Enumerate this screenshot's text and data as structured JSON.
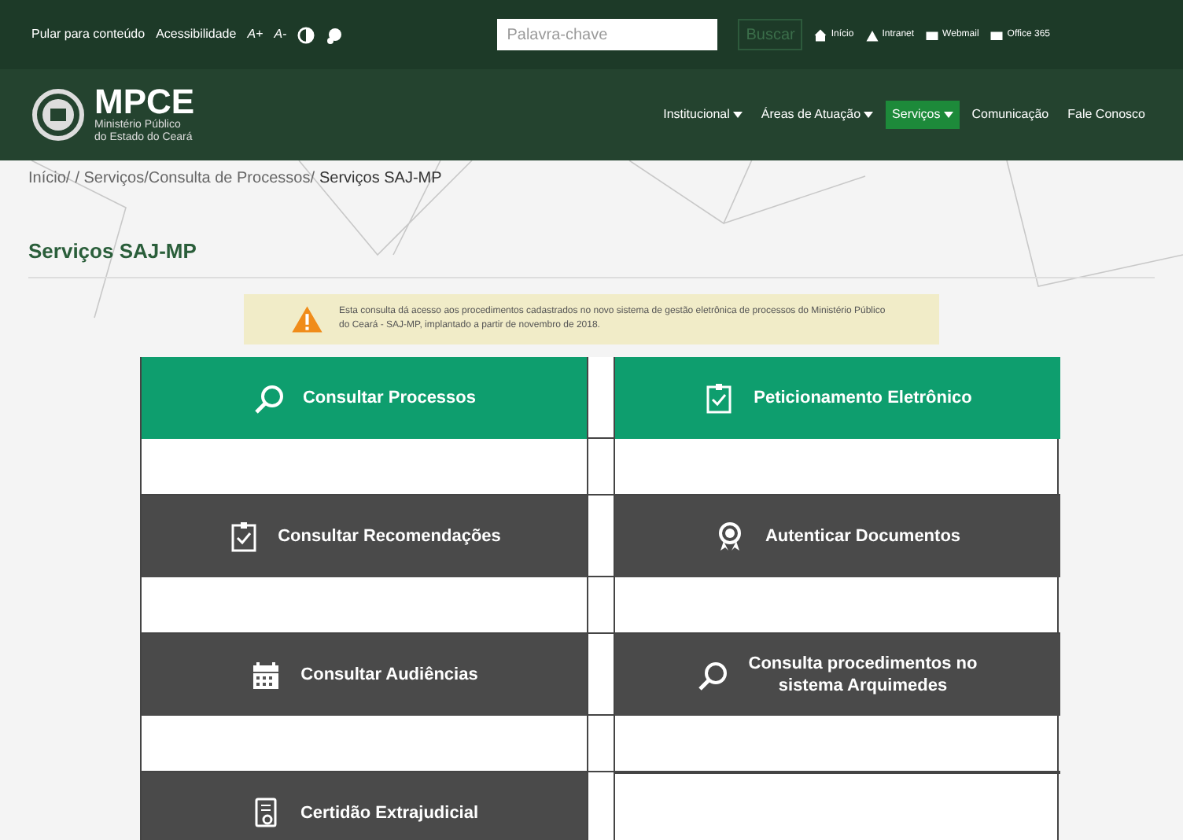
{
  "top_bar": {
    "links": [
      "Pular para conteúdo",
      "Acessibilidade"
    ],
    "font_controls": [
      "A+",
      "A-"
    ],
    "search": {
      "placeholder": "Palavra-chave",
      "button": "Buscar"
    },
    "quick_links": [
      {
        "kind": "home",
        "label": "Início"
      },
      {
        "kind": "intranet",
        "label": "Intranet"
      },
      {
        "kind": "mail",
        "label": "Webmail"
      },
      {
        "kind": "mail",
        "label": "Office 365"
      }
    ]
  },
  "header": {
    "logo": {
      "title": "MPCE",
      "subtitle": [
        "Ministério Público",
        "do Estado do Ceará"
      ]
    },
    "nav": [
      {
        "label": "Institucional",
        "dropdown": true,
        "selected": false
      },
      {
        "label": "Áreas de Atuação",
        "dropdown": true,
        "selected": false
      },
      {
        "label": "Serviços",
        "dropdown": true,
        "selected": true
      },
      {
        "label": "Comunicação",
        "dropdown": false,
        "selected": false
      },
      {
        "label": "Fale Conosco",
        "dropdown": false,
        "selected": false
      }
    ]
  },
  "breadcrumb": {
    "links": [
      "Início/",
      "/ Serviços/Consulta de Processos/"
    ],
    "current": "Serviços SAJ-MP"
  },
  "page_title": "Serviços SAJ-MP",
  "notice": "Esta consulta dá acesso aos procedimentos cadastrados no novo sistema de gestão eletrônica de processos do Ministério Público do Ceará - SAJ-MP, implantado a partir de novembro de 2018.",
  "services": [
    {
      "kind": "featured",
      "label": "Consultar Processos"
    },
    {
      "kind": "featured",
      "label": "Peticionamento Eletrônico"
    },
    {
      "kind": "standard",
      "label": "Consultar Recomendações"
    },
    {
      "kind": "standard",
      "label": "Autenticar Documentos"
    },
    {
      "kind": "standard",
      "label": "Consultar Audiências"
    },
    {
      "kind": "standard",
      "label": "Consulta procedimentos no sistema Arquimedes"
    },
    {
      "kind": "standard",
      "label": "Certidão Extrajudicial"
    }
  ]
}
